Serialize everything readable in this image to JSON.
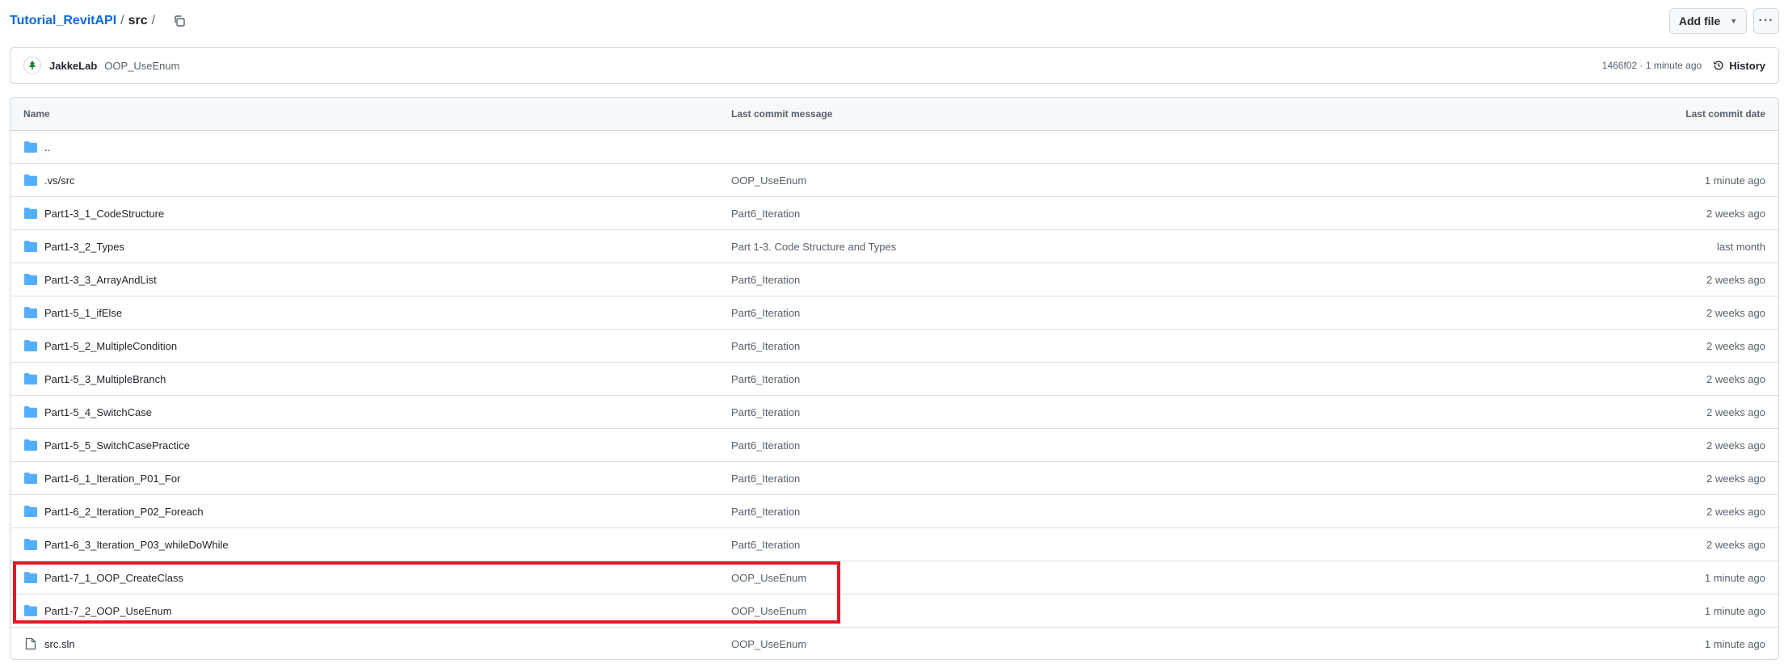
{
  "breadcrumb": {
    "repo": "Tutorial_RevitAPI",
    "sep1": "/",
    "folder": "src",
    "sep2": "/"
  },
  "actions": {
    "add_file_label": "Add file",
    "more_label": "···"
  },
  "latest_commit": {
    "author": "JakkeLab",
    "message": "OOP_UseEnum",
    "meta": "1466f02 · 1 minute ago",
    "history_label": "History"
  },
  "table": {
    "headers": {
      "name": "Name",
      "message": "Last commit message",
      "date": "Last commit date"
    },
    "rows": [
      {
        "type": "folder",
        "name": "..",
        "message": "",
        "date": ""
      },
      {
        "type": "folder",
        "name": ".vs/src",
        "message": "OOP_UseEnum",
        "date": "1 minute ago"
      },
      {
        "type": "folder",
        "name": "Part1-3_1_CodeStructure",
        "message": "Part6_Iteration",
        "date": "2 weeks ago"
      },
      {
        "type": "folder",
        "name": "Part1-3_2_Types",
        "message": "Part 1-3. Code Structure and Types",
        "date": "last month"
      },
      {
        "type": "folder",
        "name": "Part1-3_3_ArrayAndList",
        "message": "Part6_Iteration",
        "date": "2 weeks ago"
      },
      {
        "type": "folder",
        "name": "Part1-5_1_ifElse",
        "message": "Part6_Iteration",
        "date": "2 weeks ago"
      },
      {
        "type": "folder",
        "name": "Part1-5_2_MultipleCondition",
        "message": "Part6_Iteration",
        "date": "2 weeks ago"
      },
      {
        "type": "folder",
        "name": "Part1-5_3_MultipleBranch",
        "message": "Part6_Iteration",
        "date": "2 weeks ago"
      },
      {
        "type": "folder",
        "name": "Part1-5_4_SwitchCase",
        "message": "Part6_Iteration",
        "date": "2 weeks ago"
      },
      {
        "type": "folder",
        "name": "Part1-5_5_SwitchCasePractice",
        "message": "Part6_Iteration",
        "date": "2 weeks ago"
      },
      {
        "type": "folder",
        "name": "Part1-6_1_Iteration_P01_For",
        "message": "Part6_Iteration",
        "date": "2 weeks ago"
      },
      {
        "type": "folder",
        "name": "Part1-6_2_Iteration_P02_Foreach",
        "message": "Part6_Iteration",
        "date": "2 weeks ago"
      },
      {
        "type": "folder",
        "name": "Part1-6_3_Iteration_P03_whileDoWhile",
        "message": "Part6_Iteration",
        "date": "2 weeks ago"
      },
      {
        "type": "folder",
        "name": "Part1-7_1_OOP_CreateClass",
        "message": "OOP_UseEnum",
        "date": "1 minute ago"
      },
      {
        "type": "folder",
        "name": "Part1-7_2_OOP_UseEnum",
        "message": "OOP_UseEnum",
        "date": "1 minute ago"
      },
      {
        "type": "file",
        "name": "src.sln",
        "message": "OOP_UseEnum",
        "date": "1 minute ago"
      }
    ]
  },
  "colors": {
    "link": "#0969da",
    "folder_icon": "#54aeff",
    "highlight": "#e11b22"
  }
}
